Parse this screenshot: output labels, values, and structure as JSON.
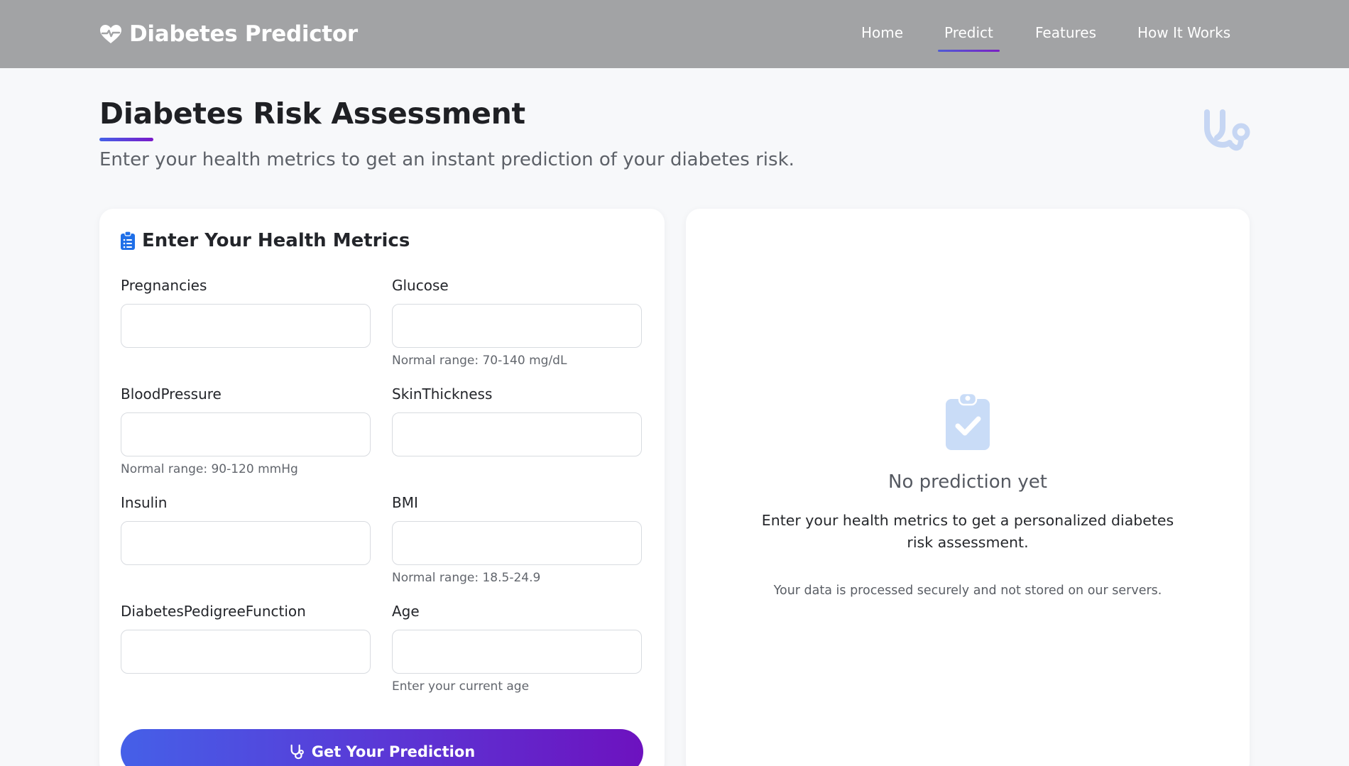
{
  "nav": {
    "brand": "Diabetes Predictor",
    "links": [
      {
        "label": "Home",
        "active": false
      },
      {
        "label": "Predict",
        "active": true
      },
      {
        "label": "Features",
        "active": false
      },
      {
        "label": "How It Works",
        "active": false
      }
    ]
  },
  "header": {
    "title": "Diabetes Risk Assessment",
    "subtitle": "Enter your health metrics to get an instant prediction of your diabetes risk."
  },
  "form": {
    "title": "Enter Your Health Metrics",
    "fields": [
      {
        "label": "Pregnancies",
        "value": "",
        "hint": ""
      },
      {
        "label": "Glucose",
        "value": "",
        "hint": "Normal range: 70-140 mg/dL"
      },
      {
        "label": "BloodPressure",
        "value": "",
        "hint": "Normal range: 90-120 mmHg"
      },
      {
        "label": "SkinThickness",
        "value": "",
        "hint": ""
      },
      {
        "label": "Insulin",
        "value": "",
        "hint": ""
      },
      {
        "label": "BMI",
        "value": "",
        "hint": "Normal range: 18.5-24.9"
      },
      {
        "label": "DiabetesPedigreeFunction",
        "value": "",
        "hint": ""
      },
      {
        "label": "Age",
        "value": "",
        "hint": "Enter your current age"
      }
    ],
    "submit_label": "Get Your Prediction"
  },
  "result": {
    "empty_title": "No prediction yet",
    "empty_text": "Enter your health metrics to get a personalized diabetes risk assessment.",
    "privacy_note": "Your data is processed securely and not stored on our servers."
  },
  "icons": {
    "brand": "heart-pulse-icon",
    "form_title": "clipboard-list-icon",
    "submit": "stethoscope-icon",
    "result_empty": "clipboard-check-icon",
    "header_decoration": "stethoscope-icon"
  },
  "colors": {
    "navbar_bg": "#a2a3a5",
    "accent_start": "#4560e8",
    "accent_end": "#6d12bf",
    "form_icon": "#1f6fe8",
    "empty_icon": "#c9dcf7"
  }
}
